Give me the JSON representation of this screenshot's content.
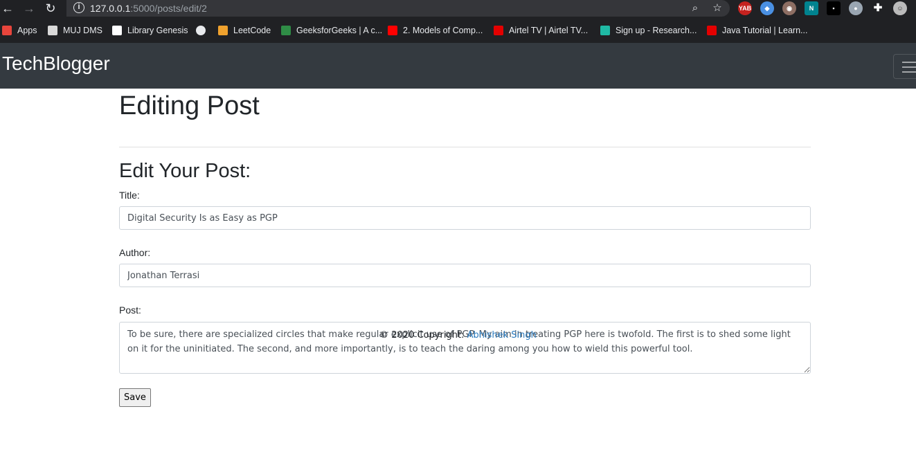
{
  "browser": {
    "url_host": "127.0.0.1",
    "url_rest": ":5000/posts/edit/2",
    "bookmarks": [
      {
        "label": "Apps",
        "color": "#e8453c"
      },
      {
        "label": "MUJ DMS",
        "color": "#d9d9d9"
      },
      {
        "label": "Library Genesis",
        "color": "#ffffff"
      },
      {
        "label": "",
        "color": "#e8eaed"
      },
      {
        "label": "LeetCode",
        "color": "#f0a22e"
      },
      {
        "label": "GeeksforGeeks | A c...",
        "color": "#2f8d46"
      },
      {
        "label": "2. Models of Comp...",
        "color": "#ff0000"
      },
      {
        "label": "Airtel TV | Airtel TV...",
        "color": "#e40000"
      },
      {
        "label": "Sign up - Research...",
        "color": "#1fb9a4"
      },
      {
        "label": "Java Tutorial | Learn...",
        "color": "#e40000"
      }
    ]
  },
  "navbar": {
    "brand": "TechBlogger"
  },
  "main": {
    "page_title": "Editing Post",
    "form_heading": "Edit Your Post:",
    "title_label": "Title:",
    "title_value": "Digital Security Is as Easy as PGP",
    "author_label": "Author:",
    "author_value": "Jonathan Terrasi",
    "post_label": "Post:",
    "post_value": "To be sure, there are specialized circles that make regular explicit use of PGP. My aim in treating PGP here is twofold. The first is to shed some light on it for the uninitiated. The second, and more importantly, is to teach the daring among you how to wield this powerful tool.",
    "save_label": "Save"
  },
  "footer": {
    "copyright": "© 2020 Copyright: ",
    "author_link": "Abhishek Singh"
  }
}
